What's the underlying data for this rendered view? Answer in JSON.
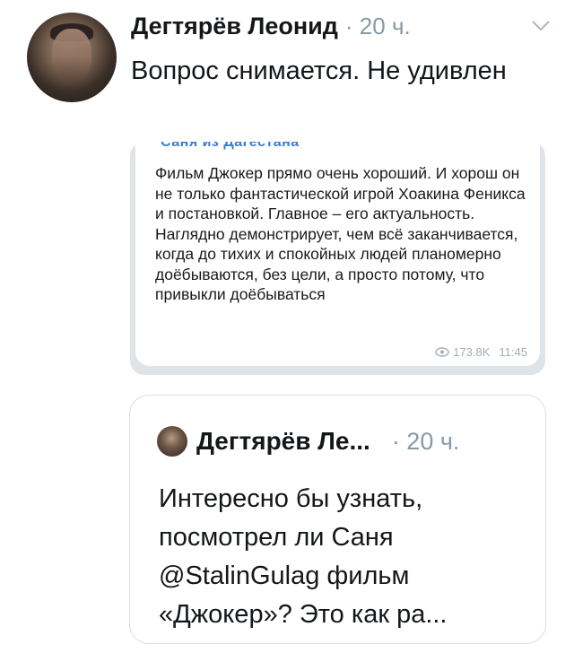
{
  "tweet": {
    "author_name": "Дегтярёв Леонид",
    "time": "· 20 ч.",
    "text": "Вопрос снимается. Не удивлен"
  },
  "media": {
    "cut_header": "Саня из Дагестана",
    "message": "Фильм Джокер прямо очень хороший. И хорош он не только фантастической игрой Хоакина Феникса и постановкой. Главное – его актуальность. Наглядно демонстрирует, чем всё заканчивается, когда до тихих и спокойных людей планомерно доёбываются, без цели, а просто потому, что привыкли доёбываться",
    "views": "173.8K",
    "time": "11:45"
  },
  "quote": {
    "author_name": "Дегтярёв Ле...",
    "time": "· 20 ч.",
    "text": "Интересно бы узнать, посмотрел ли Саня @StalinGulag фильм «Джокер»? Это как ра..."
  },
  "icons": {
    "more": "chevron-down-icon",
    "views": "eye-icon"
  },
  "colors": {
    "text": "#14171a",
    "secondary": "#8899a6",
    "border": "#d7dee3"
  }
}
